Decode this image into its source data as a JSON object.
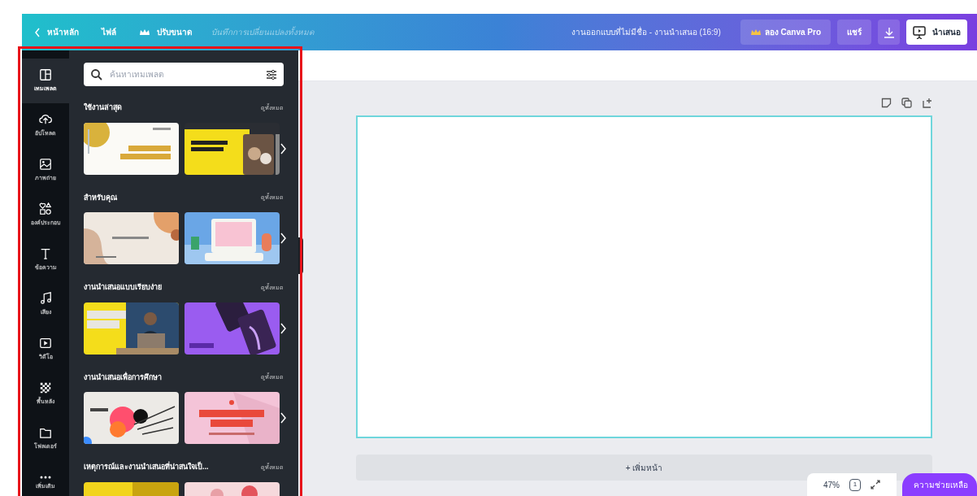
{
  "top_bar": {
    "menu": [
      {
        "label": "หน้าหลัก",
        "kind": "back"
      },
      {
        "label": "ไฟล์",
        "kind": "plain"
      },
      {
        "label": "ปรับขนาด",
        "kind": "crown"
      }
    ],
    "save_status": "บันทึกการเปลี่ยนแปลงทั้งหมด",
    "title": "งานออกแบบที่ไม่มีชื่อ - งานนำเสนอ (16:9)",
    "buttons": [
      {
        "label": "ลอง Canva Pro",
        "kind": "pro"
      },
      {
        "label": "แชร์",
        "kind": "share"
      },
      {
        "kind": "download"
      },
      {
        "label": "นำเสนอ",
        "kind": "present"
      }
    ]
  },
  "side_rail": [
    {
      "label": "เทมเพลต",
      "kind": "templates",
      "selected": true
    },
    {
      "label": "อัปโหลด",
      "kind": "upload",
      "selected": false
    },
    {
      "label": "ภาพถ่าย",
      "kind": "photos",
      "selected": false
    },
    {
      "label": "องค์ประกอบ",
      "kind": "elements",
      "selected": false
    },
    {
      "label": "ข้อความ",
      "kind": "text",
      "selected": false
    },
    {
      "label": "เสียง",
      "kind": "audio",
      "selected": false
    },
    {
      "label": "วิดีโอ",
      "kind": "video",
      "selected": false
    },
    {
      "label": "พื้นหลัง",
      "kind": "background",
      "selected": false
    },
    {
      "label": "โฟลเดอร์",
      "kind": "folder",
      "selected": false
    },
    {
      "label": "เพิ่มเติม",
      "kind": "more",
      "selected": false
    }
  ],
  "panel": {
    "search": {
      "placeholder": "ค้นหาเทมเพลต"
    },
    "sections": [
      {
        "title": "ใช้งานล่าสุด",
        "link": "ดูทั้งหมด",
        "next_arrow": true
      },
      {
        "title": "สำหรับคุณ",
        "link": "ดูทั้งหมด",
        "next_arrow": true
      },
      {
        "title": "งานนำเสนอแบบเรียบง่าย",
        "link": "ดูทั้งหมด",
        "next_arrow": true
      },
      {
        "title": "งานนำเสนอเพื่อการศึกษา",
        "link": "ดูทั้งหมด",
        "next_arrow": true
      },
      {
        "title": "เหตุการณ์และงานนำเสนอที่น่าสนใจเป็...",
        "link": "ดูทั้งหมด",
        "next_arrow": false
      }
    ]
  },
  "canvas": {
    "add_page": "+ เพิ่มหน้า"
  },
  "footer": {
    "zoom": "47%",
    "page_count": "1",
    "help": "ความช่วยเหลือ"
  }
}
